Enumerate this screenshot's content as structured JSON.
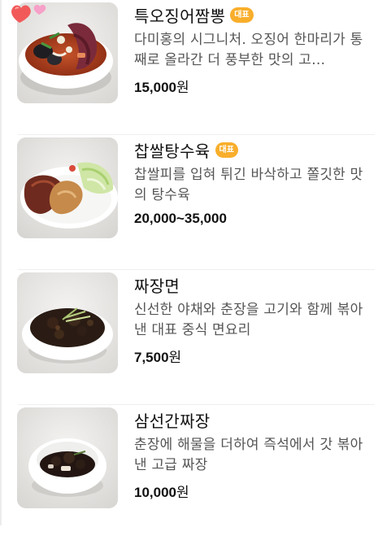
{
  "menu": {
    "items": [
      {
        "name": "특오징어짬뽕",
        "badge": "대표",
        "description": "다미홍의 시그니처. 오징어 한마리가 통째로 올라간 더 풍부한 맛의 고…",
        "price": "15,000",
        "currency": "원",
        "image_icon": "jjamppong-dish-photo"
      },
      {
        "name": "찹쌀탕수육",
        "badge": "대표",
        "description": "찹쌀피를 입혀 튀긴 바삭하고 쫄깃한 맛의 탕수육",
        "price": "20,000~35,000",
        "currency": "",
        "image_icon": "tangsuyuk-dish-photo"
      },
      {
        "name": "짜장면",
        "badge": "",
        "description": "신선한 야채와 춘장을 고기와 함께 볶아낸 대표 중식 면요리",
        "price": "7,500",
        "currency": "원",
        "image_icon": "jajangmyeon-dish-photo"
      },
      {
        "name": "삼선간짜장",
        "badge": "",
        "description": "춘장에 해물을 더하여 즉석에서 갓 볶아낸 고급 짜장",
        "price": "10,000",
        "currency": "원",
        "image_icon": "ganjjajang-dish-photo"
      }
    ]
  },
  "decoration": {
    "icon": "hearts-icon",
    "colors": [
      "#f25a5a",
      "#f7a0c8"
    ]
  },
  "colors": {
    "badge": "#f8ae2b",
    "text": "#111111",
    "description": "#555555",
    "divider": "#efefef"
  }
}
